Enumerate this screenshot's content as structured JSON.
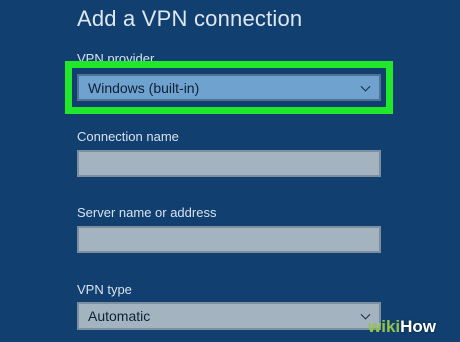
{
  "page": {
    "title": "Add a VPN connection"
  },
  "form": {
    "vpn_provider": {
      "label": "VPN provider",
      "value": "Windows (built-in)"
    },
    "connection_name": {
      "label": "Connection name",
      "value": ""
    },
    "server_name": {
      "label": "Server name or address",
      "value": ""
    },
    "vpn_type": {
      "label": "VPN type",
      "value": "Automatic"
    }
  },
  "watermark": {
    "brand_part1": "wiki",
    "brand_part2": "How"
  },
  "colors": {
    "background": "#114070",
    "highlight": "#22e82b",
    "selected_dropdown": "#6fa2cf",
    "field": "#a4b3c0",
    "text_light": "#dfe7f0"
  },
  "icons": {
    "dropdown": "chevron-down-icon"
  }
}
